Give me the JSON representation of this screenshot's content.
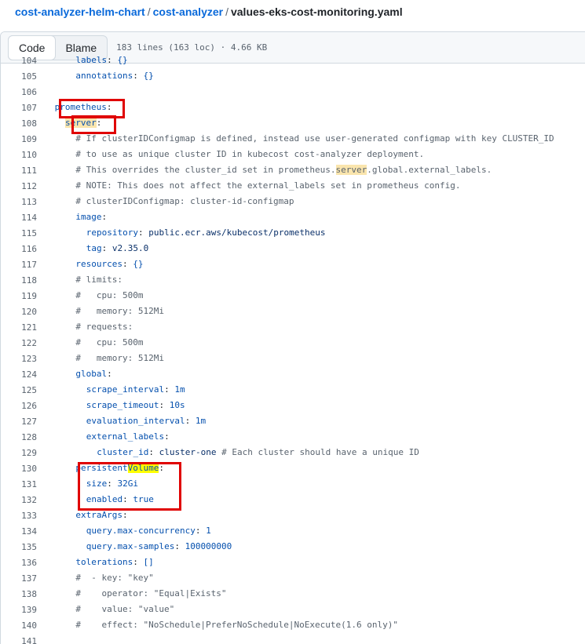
{
  "breadcrumb": {
    "repo": "cost-analyzer-helm-chart",
    "folder": "cost-analyzer",
    "separator": "/",
    "file": "values-eks-cost-monitoring.yaml"
  },
  "toolbar": {
    "code_label": "Code",
    "blame_label": "Blame",
    "file_info": "183 lines (163 loc) · 4.66 KB"
  },
  "code_lines": [
    {
      "num": "104",
      "text": "labels: {}"
    },
    {
      "num": "105",
      "text": "annotations: {}"
    },
    {
      "num": "106",
      "text": ""
    },
    {
      "num": "107",
      "text": "prometheus:"
    },
    {
      "num": "108",
      "text": "server:"
    },
    {
      "num": "109",
      "text": "# If clusterIDConfigmap is defined, instead use user-generated configmap with key CLUSTER_ID"
    },
    {
      "num": "110",
      "text": "# to use as unique cluster ID in kubecost cost-analyzer deployment."
    },
    {
      "num": "111",
      "text": "# This overrides the cluster_id set in prometheus.server.global.external_labels."
    },
    {
      "num": "112",
      "text": "# NOTE: This does not affect the external_labels set in prometheus config."
    },
    {
      "num": "113",
      "text": "# clusterIDConfigmap: cluster-id-configmap"
    },
    {
      "num": "114",
      "text": "image:"
    },
    {
      "num": "115",
      "text": "repository: public.ecr.aws/kubecost/prometheus"
    },
    {
      "num": "116",
      "text": "tag: v2.35.0"
    },
    {
      "num": "117",
      "text": "resources: {}"
    },
    {
      "num": "118",
      "text": "# limits:"
    },
    {
      "num": "119",
      "text": "#   cpu: 500m"
    },
    {
      "num": "120",
      "text": "#   memory: 512Mi"
    },
    {
      "num": "121",
      "text": "# requests:"
    },
    {
      "num": "122",
      "text": "#   cpu: 500m"
    },
    {
      "num": "123",
      "text": "#   memory: 512Mi"
    },
    {
      "num": "124",
      "text": "global:"
    },
    {
      "num": "125",
      "text": "scrape_interval: 1m"
    },
    {
      "num": "126",
      "text": "scrape_timeout: 10s"
    },
    {
      "num": "127",
      "text": "evaluation_interval: 1m"
    },
    {
      "num": "128",
      "text": "external_labels:"
    },
    {
      "num": "129",
      "text": "cluster_id: cluster-one # Each cluster should have a unique ID"
    },
    {
      "num": "130",
      "text": "persistentVolume:"
    },
    {
      "num": "131",
      "text": "size: 32Gi"
    },
    {
      "num": "132",
      "text": "enabled: true"
    },
    {
      "num": "133",
      "text": "extraArgs:"
    },
    {
      "num": "134",
      "text": "query.max-concurrency: 1"
    },
    {
      "num": "135",
      "text": "query.max-samples: 100000000"
    },
    {
      "num": "136",
      "text": "tolerations: []"
    },
    {
      "num": "137",
      "text": "#  - key: \"key\""
    },
    {
      "num": "138",
      "text": "#    operator: \"Equal|Exists\""
    },
    {
      "num": "139",
      "text": "#    value: \"value\""
    },
    {
      "num": "140",
      "text": "#    effect: \"NoSchedule|PreferNoSchedule|NoExecute(1.6 only)\""
    },
    {
      "num": "141",
      "text": ""
    }
  ],
  "colors": {
    "link": "#0969da",
    "key": "#0550ae",
    "string": "#0a3069",
    "comment": "#59636e",
    "annotation_box": "#e00000",
    "search_highlight": "#fae5ad",
    "active_highlight": "#ffff00"
  }
}
